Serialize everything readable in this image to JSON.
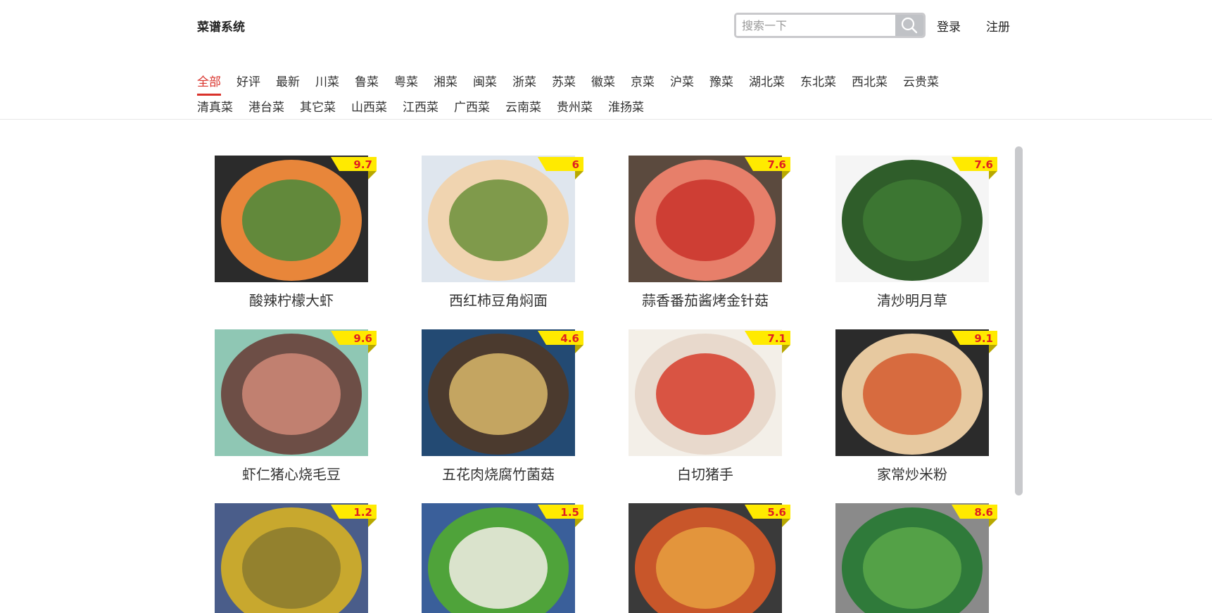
{
  "header": {
    "brand": "菜谱系统",
    "search_placeholder": "搜索一下",
    "login_label": "登录",
    "register_label": "注册"
  },
  "categories": {
    "row1": [
      "全部",
      "好评",
      "最新",
      "川菜",
      "鲁菜",
      "粤菜",
      "湘菜",
      "闽菜",
      "浙菜",
      "苏菜",
      "徽菜",
      "京菜",
      "沪菜",
      "豫菜",
      "湖北菜",
      "东北菜",
      "西北菜",
      "云贵菜"
    ],
    "row2": [
      "清真菜",
      "港台菜",
      "其它菜",
      "山西菜",
      "江西菜",
      "广西菜",
      "云南菜",
      "贵州菜",
      "淮扬菜"
    ],
    "active": "全部",
    "active_color": "#d9322b"
  },
  "recipes": [
    {
      "title": "酸辣柠檬大虾",
      "score": "9.7",
      "colors": [
        "#2b2b2b",
        "#e8863a",
        "#4a8a3c"
      ]
    },
    {
      "title": "西红柿豆角焖面",
      "score": "6",
      "colors": [
        "#dfe6ee",
        "#f0d4b0",
        "#6b8f3a"
      ]
    },
    {
      "title": "蒜香番茄酱烤金针菇",
      "score": "7.6",
      "colors": [
        "#5b4a3e",
        "#e77f6a",
        "#c9322a"
      ]
    },
    {
      "title": "清炒明月草",
      "score": "7.6",
      "colors": [
        "#f5f5f5",
        "#2f5d2a",
        "#3e7a34"
      ]
    },
    {
      "title": "虾仁猪心烧毛豆",
      "score": "9.6",
      "colors": [
        "#8fc7b4",
        "#6d4e46",
        "#d08a78"
      ]
    },
    {
      "title": "五花肉烧腐竹菌菇",
      "score": "4.6",
      "colors": [
        "#234a73",
        "#4b3a2e",
        "#d9b86a"
      ]
    },
    {
      "title": "白切猪手",
      "score": "7.1",
      "colors": [
        "#f3efe8",
        "#e8d9cc",
        "#d63c2a"
      ]
    },
    {
      "title": "家常炒米粉",
      "score": "9.1",
      "colors": [
        "#2b2b2b",
        "#e7c9a0",
        "#d45a2e"
      ]
    },
    {
      "title": "",
      "score": "1.2",
      "colors": [
        "#4a5d8a",
        "#c8a82e",
        "#8a7a2e"
      ]
    },
    {
      "title": "",
      "score": "1.5",
      "colors": [
        "#3a5f9a",
        "#4fa33a",
        "#f2efe6"
      ]
    },
    {
      "title": "",
      "score": "5.6",
      "colors": [
        "#3a3a3a",
        "#c8562a",
        "#e8a040"
      ]
    },
    {
      "title": "",
      "score": "8.6",
      "colors": [
        "#8a8a8a",
        "#2f7a3a",
        "#5aa84a"
      ]
    }
  ],
  "score_flag_color": "#ffea00",
  "score_text_color": "#e02020"
}
